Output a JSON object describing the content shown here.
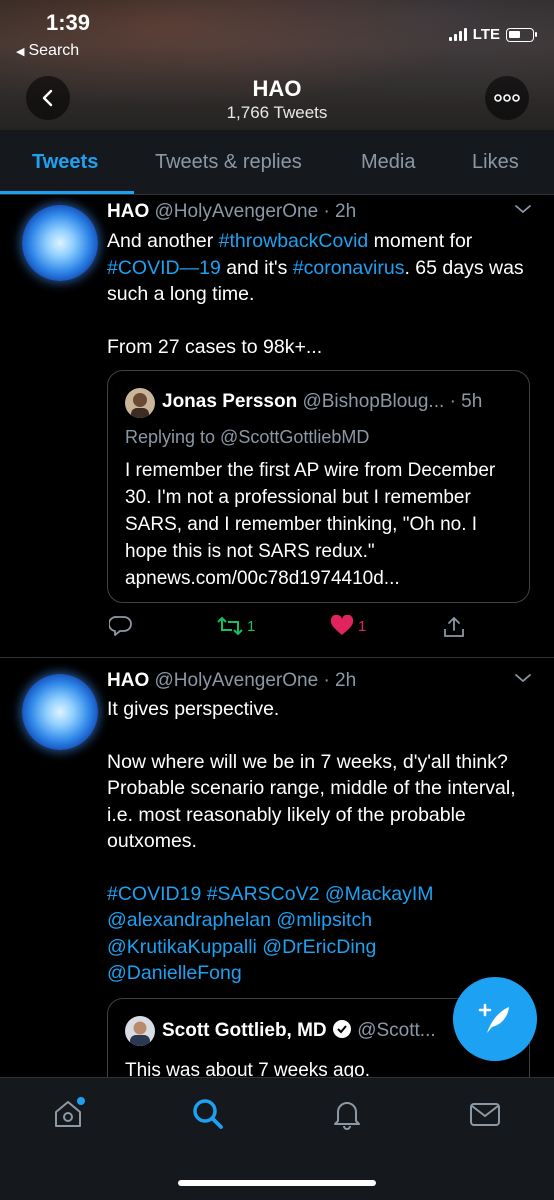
{
  "status_bar": {
    "time": "1:39",
    "back_label": "Search",
    "network": "LTE"
  },
  "header": {
    "name": "HAO",
    "tweet_count": "1,766 Tweets"
  },
  "tabs": [
    {
      "label": "Tweets",
      "active": true
    },
    {
      "label": "Tweets & replies",
      "active": false
    },
    {
      "label": "Media",
      "active": false
    },
    {
      "label": "Likes",
      "active": false
    }
  ],
  "tweets": [
    {
      "author_name": "HAO",
      "author_handle": "@HolyAvengerOne",
      "time": "· 2h",
      "body_parts": [
        {
          "text": "And another ",
          "link": false
        },
        {
          "text": "#throwbackCovid",
          "link": true
        },
        {
          "text": " moment for ",
          "link": false
        },
        {
          "text": "#COVID—19",
          "link": true
        },
        {
          "text": " and it's ",
          "link": false
        },
        {
          "text": "#coronavirus",
          "link": true
        },
        {
          "text": ". 65 days was such a long time.",
          "link": false
        }
      ],
      "body_para2": "From 27 cases to 98k+...",
      "quote": {
        "name": "Jonas Persson",
        "handle": "@BishopBloug...",
        "time": "· 5h",
        "replying_to": "Replying to @ScottGottliebMD",
        "text": "I remember the first AP wire from December 30. I'm not a professional but I remember SARS, and I remember thinking, \"Oh no. I hope this is not SARS redux.\" apnews.com/00c78d1974410d..."
      },
      "retweet_count": "1",
      "like_count": "1"
    },
    {
      "author_name": "HAO",
      "author_handle": "@HolyAvengerOne",
      "time": "· 2h",
      "body_para1": "It gives perspective.",
      "body_para2": "Now where will we be in 7 weeks, d'y'all think? Probable scenario range, middle of the interval, i.e. most reasonably likely of the probable outxomes.",
      "hashtags_line1": "#COVID19 #SARSCoV2 @MackayIM",
      "hashtags_line2": "@alexandraphelan @mlipsitch",
      "hashtags_line3": "@KrutikaKuppalli @DrEricDing",
      "hashtags_line4": "@DanielleFong",
      "quote": {
        "name": "Scott Gottlieb, MD",
        "handle": "@Scott...",
        "text": "This was about 7 weeks ago."
      }
    }
  ],
  "colors": {
    "accent": "#1da1f2",
    "retweet": "#17bf63",
    "like": "#e0245e",
    "muted": "#8b98a5"
  },
  "icons": [
    "chevron-left-icon",
    "more-icon",
    "reply-icon",
    "retweet-icon",
    "heart-icon",
    "share-icon",
    "compose-icon",
    "home-icon",
    "search-icon",
    "notifications-icon",
    "messages-icon"
  ]
}
